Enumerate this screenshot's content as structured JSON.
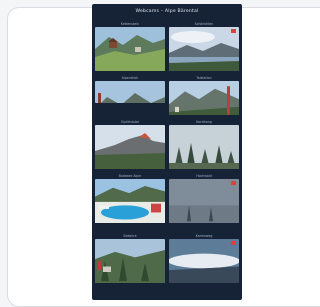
{
  "app": {
    "title": "Webcams – Alpe Bärental"
  },
  "webcams": [
    {
      "label": "Kettenstein",
      "scene": "meadow-hills-cabin"
    },
    {
      "label": "Schönleiten",
      "scene": "lake-valley-clouds"
    },
    {
      "label": "Alpenblick",
      "scene": "ridge-panorama"
    },
    {
      "label": "Talstation",
      "scene": "village-mountain"
    },
    {
      "label": "Gipfelstube",
      "scene": "summit-rocks"
    },
    {
      "label": "Nordhang",
      "scene": "forest-fog"
    },
    {
      "label": "Badesee Alpin",
      "scene": "pool-resort"
    },
    {
      "label": "Hochwald",
      "scene": "snow-fog"
    },
    {
      "label": "Seeblick",
      "scene": "houses-forest"
    },
    {
      "label": "Kammweg",
      "scene": "cloud-sea"
    }
  ]
}
